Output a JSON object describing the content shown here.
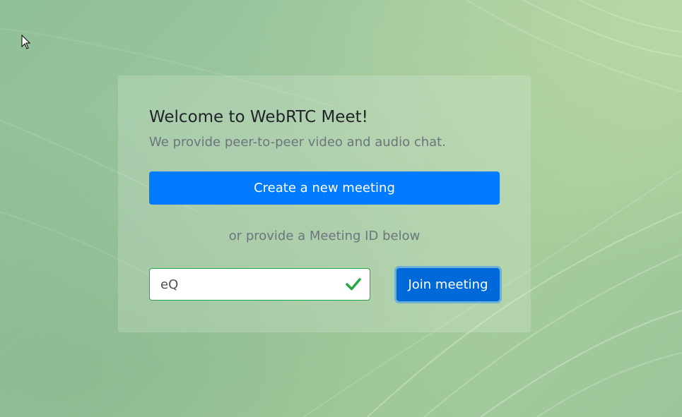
{
  "card": {
    "title": "Welcome to WebRTC Meet!",
    "subtitle": "We provide peer-to-peer video and audio chat.",
    "create_button_label": "Create a new meeting",
    "or_text": "or provide a Meeting ID below",
    "meeting_id_value": "eQ",
    "meeting_id_valid_icon": "check-icon",
    "join_button_label": "Join meeting"
  },
  "colors": {
    "primary": "#007bff",
    "primary_active": "#0069d9",
    "valid": "#28a745",
    "muted_text": "#6c757d",
    "heading_text": "#212529"
  }
}
